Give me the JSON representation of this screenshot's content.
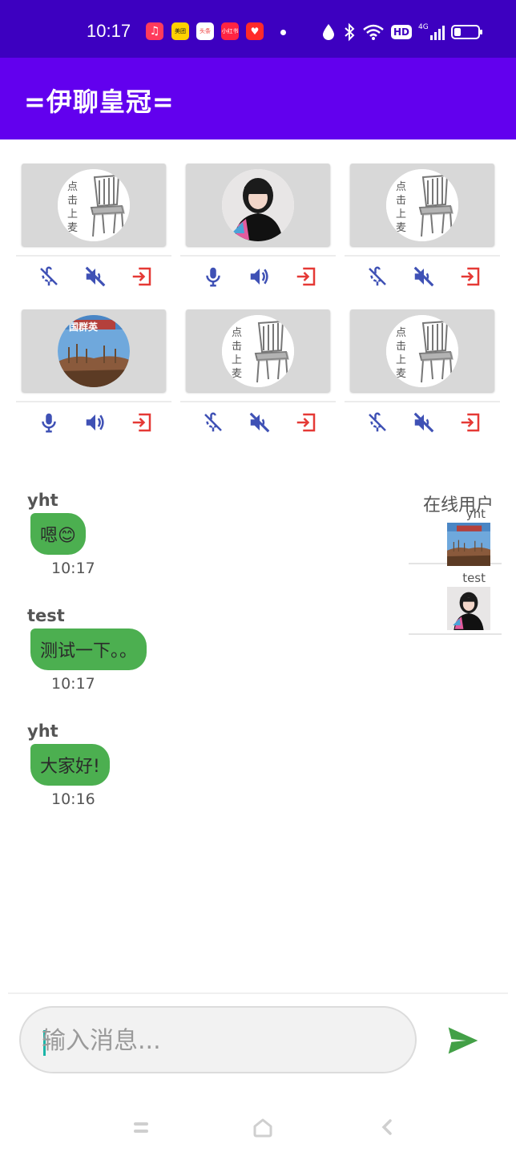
{
  "status_bar": {
    "time": "10:17",
    "notif_apps": [
      "music-app-icon",
      "meituan-icon",
      "toutiao-icon",
      "xiaohongshu-icon",
      "taobao-icon"
    ],
    "notif_labels": [
      "",
      "美团",
      "头条",
      "小红书",
      ""
    ],
    "hd_label": "HD",
    "signal_label": "4G"
  },
  "app_bar": {
    "title": "=伊聊皇冠="
  },
  "seats": [
    {
      "avatar": "empty-chair",
      "empty_label": "点击上麦",
      "mic": "off",
      "speaker": "off"
    },
    {
      "avatar": "girl-photo",
      "empty_label": "",
      "mic": "on",
      "speaker": "on"
    },
    {
      "avatar": "empty-chair",
      "empty_label": "点击上麦",
      "mic": "off",
      "speaker": "off"
    },
    {
      "avatar": "landscape-photo",
      "empty_label": "",
      "photo_caption": "国群英",
      "mic": "on",
      "speaker": "on"
    },
    {
      "avatar": "empty-chair",
      "empty_label": "点击上麦",
      "mic": "off",
      "speaker": "off"
    },
    {
      "avatar": "empty-chair",
      "empty_label": "点击上麦",
      "mic": "off",
      "speaker": "off"
    }
  ],
  "messages": [
    {
      "user": "yht",
      "text": "嗯😊",
      "time": "10:17"
    },
    {
      "user": "test",
      "text": "测试一下。。",
      "time": "10:17"
    },
    {
      "user": "yht",
      "text": "大家好!",
      "time": "10:16"
    }
  ],
  "online": {
    "title": "在线用户",
    "users": [
      {
        "name": "yht",
        "avatar": "landscape-photo"
      },
      {
        "name": "test",
        "avatar": "girl-photo"
      }
    ]
  },
  "composer": {
    "placeholder": "输入消息...",
    "value": ""
  },
  "colors": {
    "status_bar": "#3d00c0",
    "app_bar": "#6200ee",
    "bubble": "#4caf50",
    "icon_blue": "#3f51b5",
    "exit_red": "#e53935",
    "send_green": "#43a047"
  }
}
